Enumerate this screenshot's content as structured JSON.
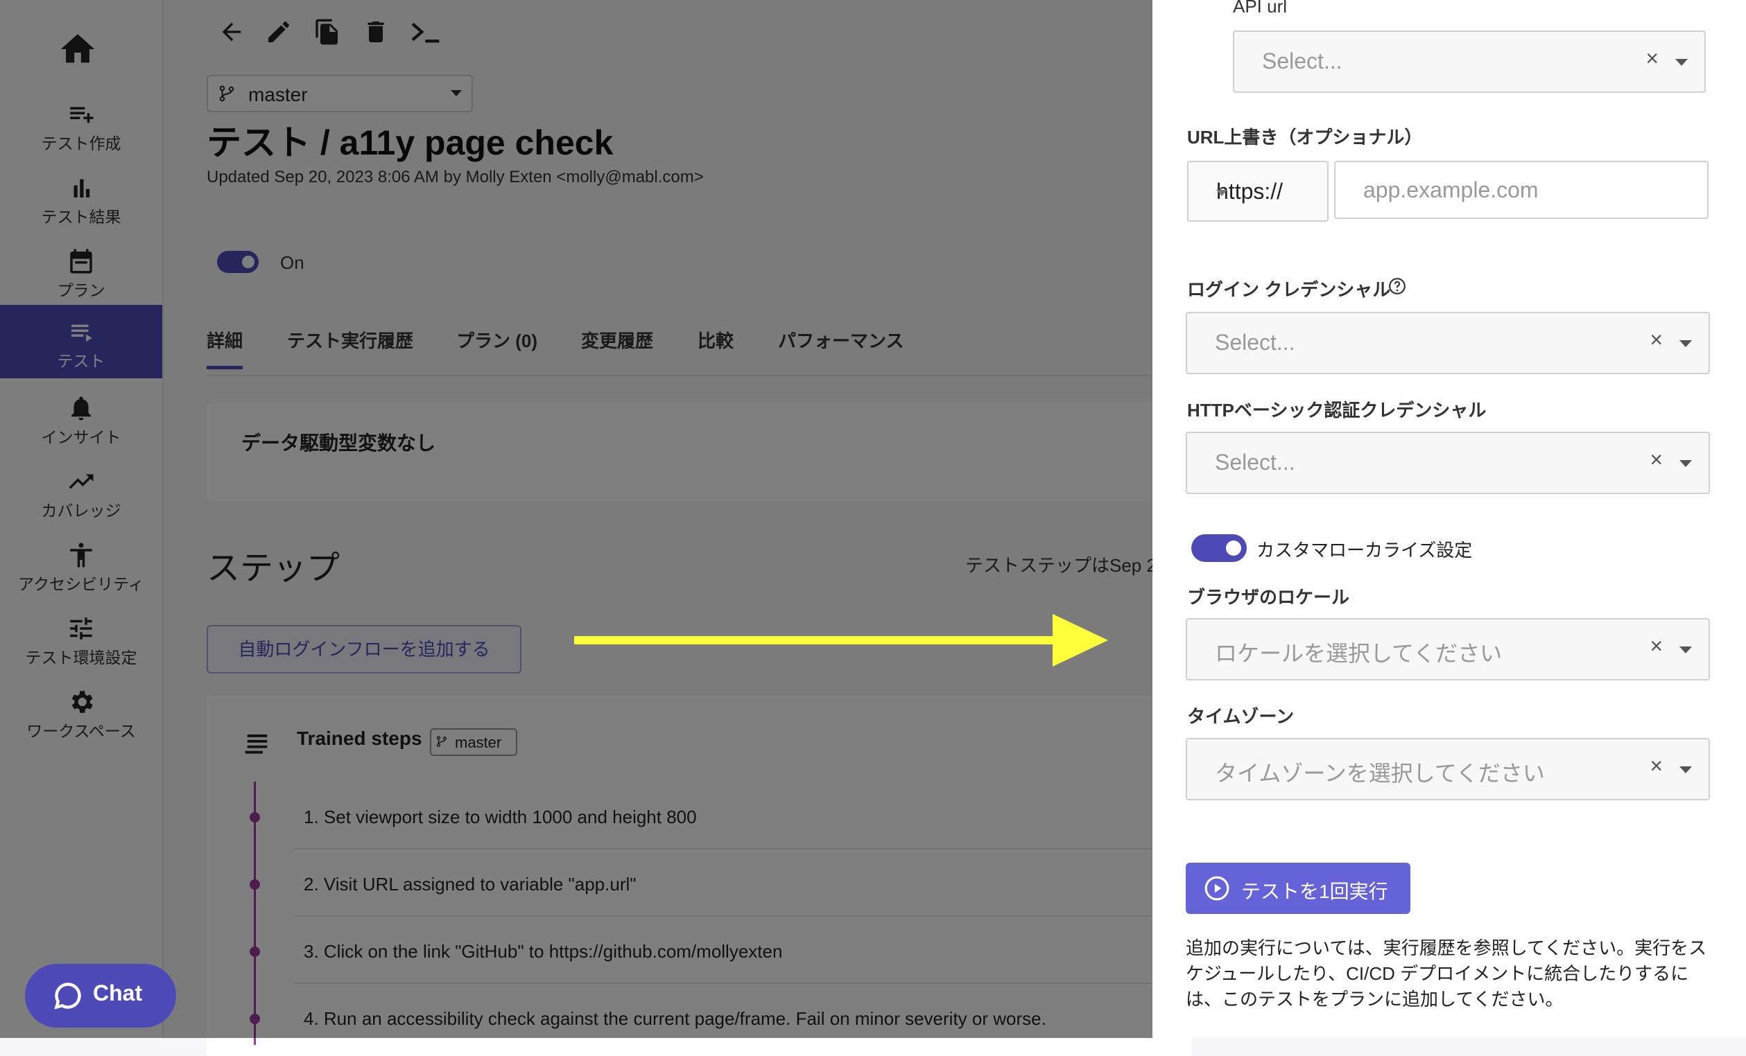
{
  "sidebar": {
    "home_icon": "home-icon",
    "items": [
      {
        "label": "テスト作成",
        "icon": "playlist-add-icon"
      },
      {
        "label": "テスト結果",
        "icon": "bar-chart-icon"
      },
      {
        "label": "プラン",
        "icon": "calendar-icon"
      },
      {
        "label": "テスト",
        "icon": "list-icon",
        "active": true
      },
      {
        "label": "インサイト",
        "icon": "bell-icon"
      },
      {
        "label": "カバレッジ",
        "icon": "trending-up-icon"
      },
      {
        "label": "アクセシビリティ",
        "icon": "accessibility-icon"
      },
      {
        "label": "テスト環境設定",
        "icon": "sliders-icon"
      },
      {
        "label": "ワークスペース",
        "icon": "gear-icon"
      }
    ]
  },
  "toolbar": {
    "icons": [
      "back-arrow-icon",
      "edit-icon",
      "copy-icon",
      "delete-icon",
      "terminal-icon"
    ]
  },
  "test": {
    "branch": "master",
    "title": "テスト / a11y page check",
    "updated": "Updated Sep 20, 2023 8:06 AM by Molly Exten <molly@mabl.com>",
    "toggle_label": "On"
  },
  "tabs": [
    {
      "label": "詳細",
      "active": true
    },
    {
      "label": "テスト実行履歴"
    },
    {
      "label": "プラン (0)"
    },
    {
      "label": "変更履歴"
    },
    {
      "label": "比較"
    },
    {
      "label": "パフォーマンス"
    }
  ],
  "datatable": {
    "empty_text": "データ駆動型変数なし"
  },
  "steps": {
    "heading": "ステップ",
    "note": "テストステップはSep 2",
    "add_login_label": "自動ログインフローを追加する",
    "trained_title": "Trained steps",
    "trained_branch": "master",
    "items": [
      "1. Set viewport size to width 1000 and height 800",
      "2. Visit URL assigned to variable \"app.url\"",
      "3. Click on the link \"GitHub\" to https://github.com/mollyexten",
      "4. Run an accessibility check against the current page/frame. Fail on minor severity or worse."
    ]
  },
  "chat": {
    "label": "Chat"
  },
  "panel": {
    "api_url": {
      "label": "API url",
      "placeholder": "Select..."
    },
    "url_override": {
      "label": "URL上書き（オプショナル）",
      "protocol": "https://",
      "placeholder": "app.example.com"
    },
    "login_credentials": {
      "label": "ログイン クレデンシャル",
      "placeholder": "Select..."
    },
    "http_basic": {
      "label": "HTTPベーシック認証クレデンシャル",
      "placeholder": "Select..."
    },
    "custom_localize": {
      "label": "カスタマローカライズ設定",
      "enabled": true
    },
    "browser_locale": {
      "label": "ブラウザのロケール",
      "placeholder": "ロケールを選択してください"
    },
    "timezone": {
      "label": "タイムゾーン",
      "placeholder": "タイムゾーンを選択してください"
    },
    "run_button": "テストを1回実行",
    "note": "追加の実行については、実行履歴を参照してください。実行をスケジュールしたり、CI/CD デプロイメントに統合したりするには、このテストをプランに追加してください。"
  },
  "colors": {
    "accent": "#4d4ab8",
    "highlight_arrow": "#ffff3c",
    "timeline": "#9b3a9b"
  }
}
